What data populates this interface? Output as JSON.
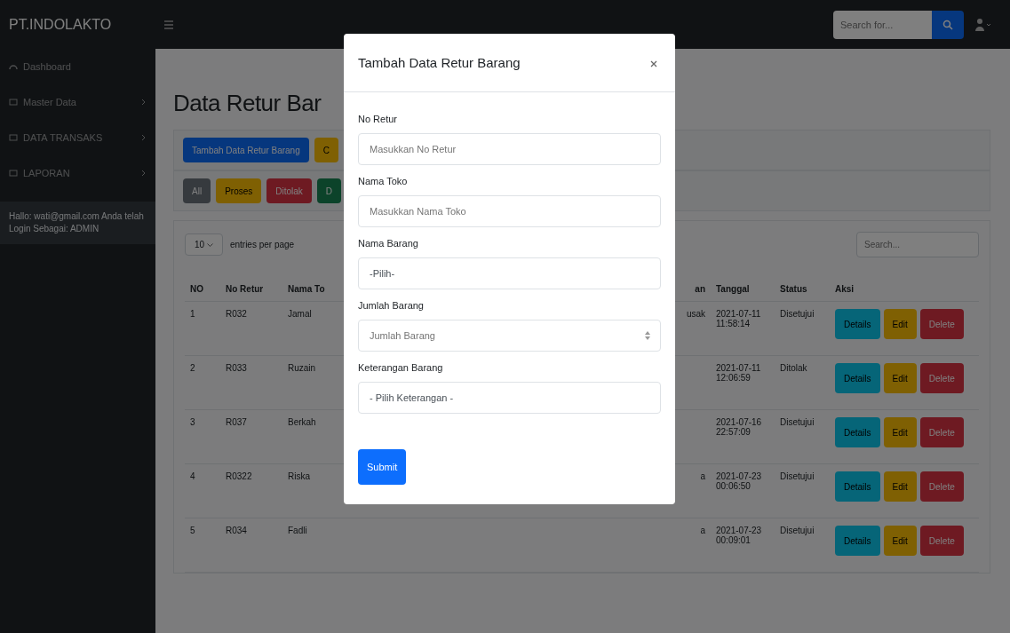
{
  "navbar": {
    "brand": "PT.INDOLAKTO",
    "search": {
      "placeholder": "Search for..."
    }
  },
  "sidebar": {
    "items": [
      {
        "label": "Dashboard",
        "expandable": false
      },
      {
        "label": "Master Data",
        "expandable": true
      },
      {
        "label": "DATA TRANSAKS",
        "expandable": true
      },
      {
        "label": "LAPORAN",
        "expandable": true
      }
    ],
    "footer": "Hallo: wati@gmail.com Anda telah Login Sebagai: ADMIN"
  },
  "page": {
    "heading": "Data Retur Bar",
    "action_buttons": [
      "Tambah Data Retur Barang",
      "C"
    ],
    "filter_buttons": [
      "All",
      "Proses",
      "Ditolak",
      "D"
    ],
    "entries": {
      "value": "10",
      "label": "entries per page"
    },
    "table_search": {
      "placeholder": "Search..."
    },
    "table": {
      "columns": [
        "NO",
        "No Retur",
        "Nama To",
        "an",
        "Tanggal",
        "Status",
        "Aksi"
      ],
      "rows": [
        {
          "no": "1",
          "no_retur": "R032",
          "nama_toko": "Jamal",
          "keterangan": "usak",
          "tanggal": "2021-07-11 11:58:14",
          "status": "Disetujui",
          "actions": [
            "Details",
            "Edit",
            "Delete"
          ]
        },
        {
          "no": "2",
          "no_retur": "R033",
          "nama_toko": "Ruzain",
          "keterangan": "",
          "tanggal": "2021-07-11 12:06:59",
          "status": "Ditolak",
          "actions": [
            "Details",
            "Edit",
            "Delete"
          ]
        },
        {
          "no": "3",
          "no_retur": "R037",
          "nama_toko": "Berkah",
          "keterangan": "",
          "tanggal": "2021-07-16 22:57:09",
          "status": "Disetujui",
          "actions": [
            "Details",
            "Edit",
            "Delete"
          ]
        },
        {
          "no": "4",
          "no_retur": "R0322",
          "nama_toko": "Riska",
          "keterangan": "a",
          "tanggal": "2021-07-23 00:06:50",
          "status": "Disetujui",
          "actions": [
            "Details",
            "Edit",
            "Delete"
          ]
        },
        {
          "no": "5",
          "no_retur": "R034",
          "nama_toko": "Fadli",
          "keterangan": "a",
          "tanggal": "2021-07-23 00:09:01",
          "status": "Disetujui",
          "actions": [
            "Details",
            "Edit",
            "Delete"
          ]
        }
      ]
    }
  },
  "modal": {
    "title": "Tambah Data Retur Barang",
    "fields": [
      {
        "label": "No Retur",
        "kind": "text",
        "placeholder": "Masukkan No Retur"
      },
      {
        "label": "Nama Toko",
        "kind": "text",
        "placeholder": "Masukkan Nama Toko"
      },
      {
        "label": "Nama Barang",
        "kind": "select",
        "value": "-Pilih-"
      },
      {
        "label": "Jumlah Barang",
        "kind": "number",
        "placeholder": "Jumlah Barang"
      },
      {
        "label": "Keterangan Barang",
        "kind": "select",
        "value": "- Pilih Keterangan -"
      }
    ],
    "submit": "Submit"
  }
}
